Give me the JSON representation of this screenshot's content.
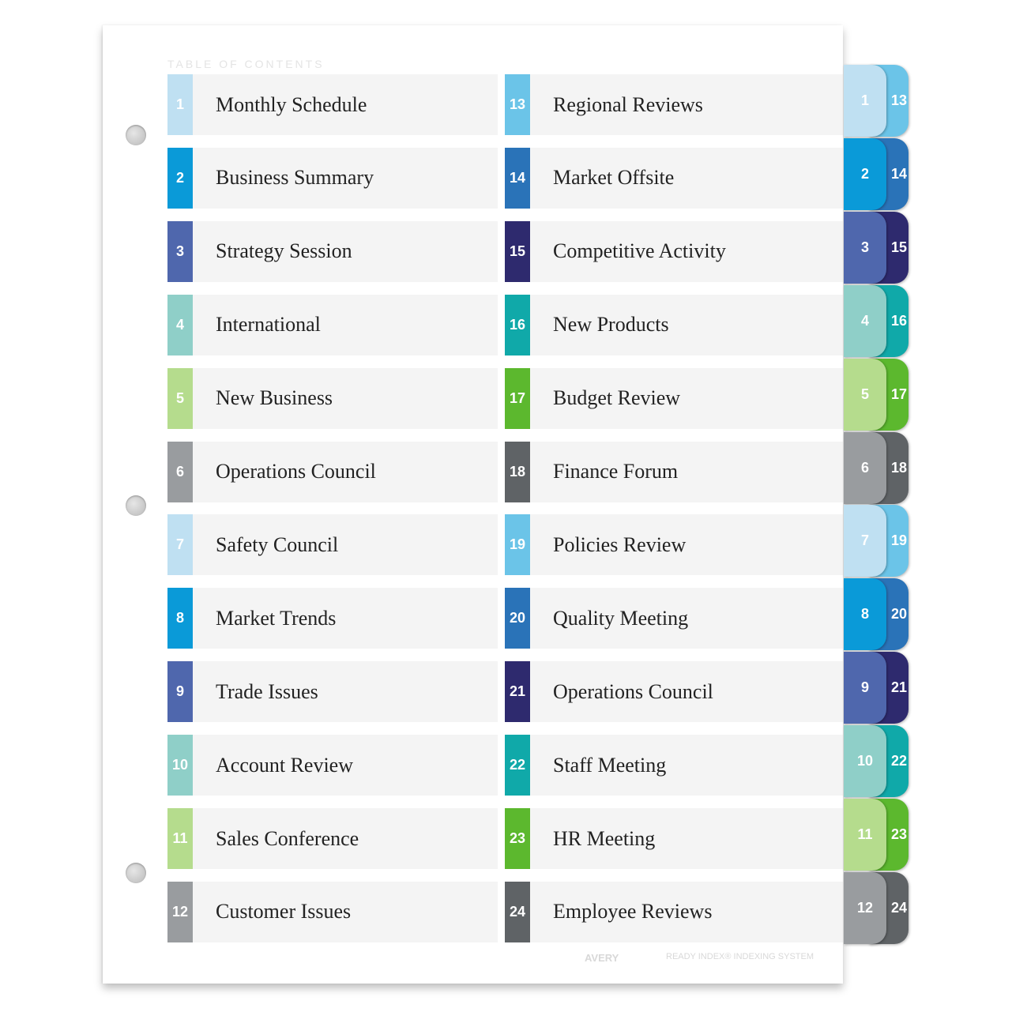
{
  "title": "TABLE OF CONTENTS",
  "entries": [
    {
      "n": "1",
      "label": "Monthly Schedule",
      "color": "#bfe0f2"
    },
    {
      "n": "2",
      "label": "Business Summary",
      "color": "#0a9ad8"
    },
    {
      "n": "3",
      "label": "Strategy Session",
      "color": "#4f67ad"
    },
    {
      "n": "4",
      "label": "International",
      "color": "#8fcfc8"
    },
    {
      "n": "5",
      "label": "New Business",
      "color": "#b5dc8d"
    },
    {
      "n": "6",
      "label": "Operations Council",
      "color": "#999c9f"
    },
    {
      "n": "7",
      "label": "Safety Council",
      "color": "#bfe0f2"
    },
    {
      "n": "8",
      "label": "Market Trends",
      "color": "#0a9ad8"
    },
    {
      "n": "9",
      "label": "Trade Issues",
      "color": "#4f67ad"
    },
    {
      "n": "10",
      "label": "Account Review",
      "color": "#8fcfc8"
    },
    {
      "n": "11",
      "label": "Sales Conference",
      "color": "#b5dc8d"
    },
    {
      "n": "12",
      "label": "Customer Issues",
      "color": "#999c9f"
    },
    {
      "n": "13",
      "label": "Regional Reviews",
      "color": "#6bc4e8"
    },
    {
      "n": "14",
      "label": "Market Offsite",
      "color": "#2a73b8"
    },
    {
      "n": "15",
      "label": "Competitive Activity",
      "color": "#2e2a6e"
    },
    {
      "n": "16",
      "label": "New Products",
      "color": "#10a9a9"
    },
    {
      "n": "17",
      "label": "Budget Review",
      "color": "#5cb82e"
    },
    {
      "n": "18",
      "label": "Finance Forum",
      "color": "#5f6366"
    },
    {
      "n": "19",
      "label": "Policies Review",
      "color": "#6bc4e8"
    },
    {
      "n": "20",
      "label": "Quality Meeting",
      "color": "#2a73b8"
    },
    {
      "n": "21",
      "label": "Operations Council",
      "color": "#2e2a6e"
    },
    {
      "n": "22",
      "label": "Staff Meeting",
      "color": "#10a9a9"
    },
    {
      "n": "23",
      "label": "HR Meeting",
      "color": "#5cb82e"
    },
    {
      "n": "24",
      "label": "Employee Reviews",
      "color": "#5f6366"
    }
  ],
  "footer": {
    "brand": "AVERY",
    "system": "READY INDEX® INDEXING SYSTEM"
  }
}
